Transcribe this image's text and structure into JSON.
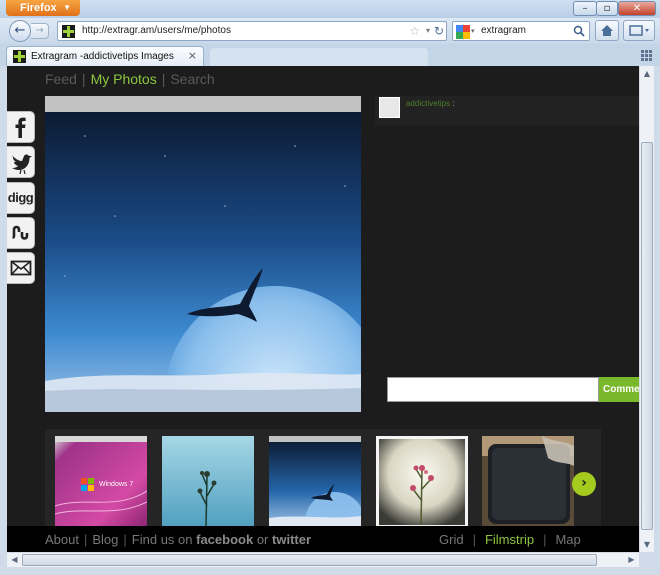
{
  "browser": {
    "app_button": "Firefox",
    "url": "http://extragr.am/users/me/photos",
    "search_engine_icon": "google-icon",
    "search_text": "extragram",
    "tab_title": "Extragram -addictivetips Images"
  },
  "site": {
    "nav": {
      "feed": "Feed",
      "my_photos": "My Photos",
      "search": "Search"
    },
    "share": [
      "facebook-icon",
      "twitter-bird-icon",
      "digg-icon",
      "stumbleupon-icon",
      "email-icon"
    ],
    "share_labels": {
      "digg": "digg"
    },
    "comment": {
      "username": "addictivetips",
      "separator": ":",
      "button": "Comment"
    },
    "thumbnails": [
      {
        "name": "windows-7-wallpaper",
        "caption": "Windows 7"
      },
      {
        "name": "flower-on-blue"
      },
      {
        "name": "bird-over-moon"
      },
      {
        "name": "pink-flower-vignette",
        "selected": true
      },
      {
        "name": "phone-on-desk"
      }
    ],
    "footer": {
      "about": "About",
      "blog": "Blog",
      "find_us": "Find us on",
      "facebook": "facebook",
      "or": "or",
      "twitter": "twitter",
      "views": {
        "grid": "Grid",
        "filmstrip": "Filmstrip",
        "map": "Map"
      }
    }
  },
  "colors": {
    "accent_green": "#8cc63f",
    "page_background": "#1c1c1c",
    "next_button": "#a4cc1e"
  }
}
